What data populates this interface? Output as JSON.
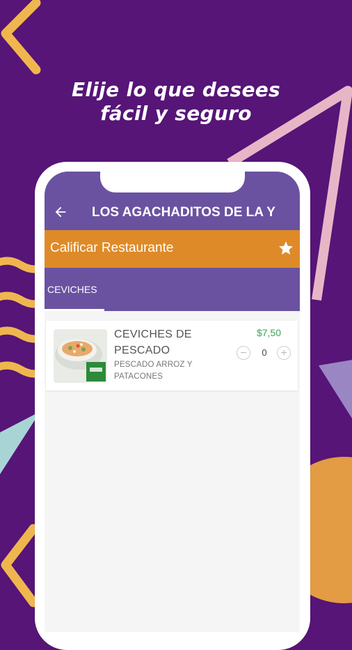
{
  "promo": {
    "line1": "Elije lo que desees",
    "line2": "fácil y seguro"
  },
  "appbar": {
    "back_icon": "arrow-left-icon",
    "title": "LOS AGACHADITOS DE LA Y"
  },
  "rating": {
    "label": "Calificar Restaurante",
    "icon": "star-icon"
  },
  "tabs": [
    {
      "label": "CEVICHES",
      "selected": true
    }
  ],
  "menu_items": [
    {
      "name": "CEVICHES DE PESCADO",
      "description": "PESCADO ARROZ Y PATACONES",
      "price": "$7,50",
      "quantity": "0",
      "decrement_icon": "minus-icon",
      "increment_icon": "plus-icon"
    }
  ],
  "colors": {
    "background": "#561577",
    "appbar": "#6a52a1",
    "rating_bar": "#de8a28",
    "price": "#3aa35a"
  }
}
